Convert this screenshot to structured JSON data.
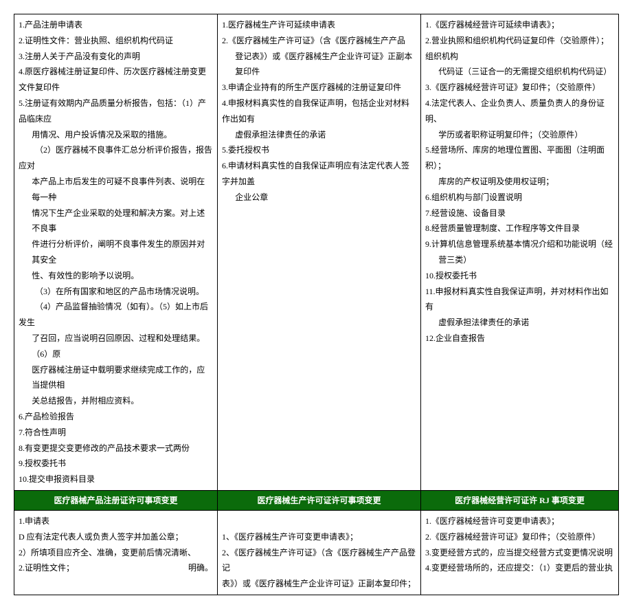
{
  "row1": {
    "col1": {
      "l1": "1.产品注册申请表",
      "l2": "2.证明性文件：营业执照、组织机构代码证",
      "l3": "3.注册人关于产品没有变化的声明",
      "l4": "4.原医疗器械注册证复印件、历次医疗器械注册变更文件复印件",
      "l5": "5.注册证有效期内产品质量分析报告，包括：（1）产品临床应",
      "l6": "用情况、用户投诉情况及采取的措施。",
      "l7": "（2）医疗器械不良事件汇总分析评价报告，报告应对",
      "l8": "本产品上市后发生的可疑不良事件列表、说明在每一种",
      "l9": "情况下生产企业采取的处理和解决方案。对上述不良事",
      "l10": "件进行分析评价，阐明不良事件发生的原因并对其安全",
      "l11": "性、有效性的影响予以说明。",
      "l12": "（3）在所有国家和地区的产品市场情况说明。",
      "l13": "（4）产品监督抽验情况（如有）。（5）如上市后发生",
      "l14": "了召回，应当说明召回原因、过程和处理结果。（6）原",
      "l15": "医疗器械注册证中载明要求继续完成工作的，应当提供相",
      "l16": "关总结报告，并附相应资料。",
      "l17": "6.产品检验报告",
      "l18": "7.符合性声明",
      "l19": "8.有变更提交变更修改的产品技术要求一式两份",
      "l20": "9.授权委托书",
      "l21": "10.提交申报资料目录"
    },
    "col2": {
      "l1": "1.医疗器械生产许可延续申请表",
      "l2": "2.《医疗器械生产许可证》（含《医疗器械生产产品",
      "l3": "登记表》）或《医疗器械生产企业许可证》正副本复印件",
      "l4": "3.申请企业持有的所生产医疗器械的注册证复印件",
      "l5": "4.申报材料真实性的自我保证声明，包括企业对材料作出如有",
      "l6": "虚假承担法律责任的承诺",
      "l7": "5.委托授权书",
      "l8": "6.申请材料真实性的自我保证声明应有法定代表人签字并加盖",
      "l9": "企业公章"
    },
    "col3": {
      "l1": "1.《医疗器械经营许可延续申请表》；",
      "l2": "2.营业执照和组织机构代码证复印件（交验原件）；组织机构",
      "l3": "代码证（三证合一的无需提交组织机构代码证）",
      "l4": "3.《医疗器械经营许可证》复印件；（交验原件）",
      "l5": "4.法定代表人、企业负责人、质量负责人的身份证明、",
      "l6": "学历或者职称证明复印件；（交验原件）",
      "l7": "5.经营场所、库房的地理位置图、平面图（注明面积）；",
      "l8": "库房的产权证明及使用权证明；",
      "l9": "6.组织机构与部门设置说明",
      "l10": "7.经营设施、设备目录",
      "l11": "8.经营质量管理制度、工作程序等文件目录",
      "l12": "9.计算机信息管理系统基本情况介绍和功能说明（经",
      "l13": "营三类）",
      "l14": "10.授权委托书",
      "l15": "11.申报材料真实性自我保证声明，并对材料作出如有",
      "l16": "虚假承担法律责任的承诺",
      "l17": "12.企业自查报告"
    }
  },
  "headers": {
    "h1": "医疗器械产品注册证许可事项变更",
    "h2": "医疗器械生产许可证许可事项变更",
    "h3": "医疗器械经营许可证许 RJ 事项变更"
  },
  "row3": {
    "col1": {
      "l1": "1.申请表",
      "l2": "D 应有法定代表人或负责人签字并加盖公章；",
      "l3": "2）所填项目应齐全、准确，变更前后情况清晰、",
      "l4a": "2.证明性文件；",
      "l4b": "明确。"
    },
    "col2": {
      "l1": "1、《医疗器械生产许可变更申请表》；",
      "l2": "2、《医疗器械生产许可证》（含《医疗器械生产产品登记",
      "l3": "表》）或《医疗器械生产企业许可证》正副本复印件；"
    },
    "col3": {
      "l1": "1.《医疗器械经营许可变更申请表》；",
      "l2": "2.《医疗器械经营许可证》复印件；（交验原件）",
      "l3": "3.变更经营方式的，应当提交经营方式变更情况说明",
      "l4": "4.变更经营场所的，还应提交：（1）变更后的营业执"
    }
  }
}
